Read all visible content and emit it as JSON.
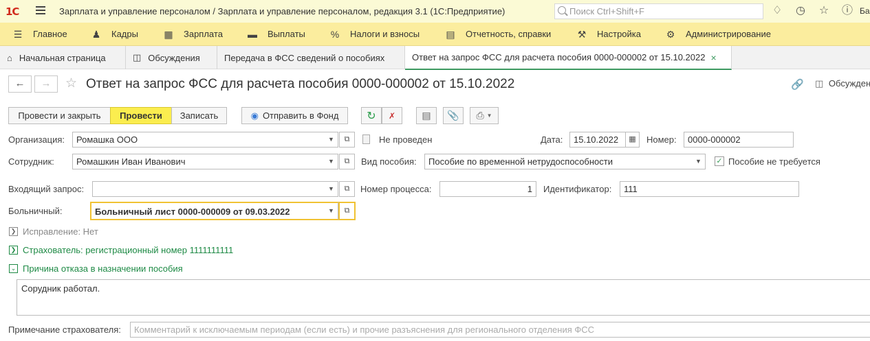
{
  "titlebar": {
    "logo": "1С",
    "title": "Зарплата и управление персоналом / Зарплата и управление персоналом, редакция 3.1  (1С:Предприятие)",
    "search_placeholder": "Поиск Ctrl+Shift+F",
    "user": "Ба"
  },
  "sections": [
    {
      "label": "Главное",
      "icon": "menu-icon"
    },
    {
      "label": "Кадры",
      "icon": "people-icon"
    },
    {
      "label": "Зарплата",
      "icon": "calculator-icon"
    },
    {
      "label": "Выплаты",
      "icon": "wallet-icon"
    },
    {
      "label": "Налоги и взносы",
      "icon": "percent-icon"
    },
    {
      "label": "Отчетность, справки",
      "icon": "reports-icon"
    },
    {
      "label": "Настройка",
      "icon": "wrench-icon"
    },
    {
      "label": "Администрирование",
      "icon": "gear-icon"
    }
  ],
  "tabs": [
    {
      "label": "Начальная страница",
      "icon": "home-icon"
    },
    {
      "label": "Обсуждения",
      "icon": "chat-icon"
    },
    {
      "label": "Передача в ФСС сведений о пособиях"
    },
    {
      "label": "Ответ на запрос ФСС для расчета пособия 0000-000002 от 15.10.2022",
      "close": "×"
    }
  ],
  "form": {
    "title": "Ответ на запрос ФСС для расчета пособия 0000-000002 от 15.10.2022",
    "discussions": "Обсужден"
  },
  "toolbar": {
    "post_close": "Провести и закрыть",
    "post": "Провести",
    "save": "Записать",
    "send_fund": "Отправить в Фонд"
  },
  "fields": {
    "org_label": "Организация:",
    "org_value": "Ромашка ООО",
    "status": "Не проведен",
    "date_label": "Дата:",
    "date_value": "15.10.2022",
    "number_label": "Номер:",
    "number_value": "0000-000002",
    "employee_label": "Сотрудник:",
    "employee_value": "Ромашкин Иван Иванович",
    "benefit_type_label": "Вид пособия:",
    "benefit_type_value": "Пособие по временной нетрудоспособности",
    "not_required_label": "Пособие не требуется",
    "not_required_checked": true,
    "incoming_label": "Входящий запрос:",
    "incoming_value": "",
    "process_label": "Номер процесса:",
    "process_value": "1",
    "ident_label": "Идентификатор:",
    "ident_value": "111",
    "sick_label": "Больничный:",
    "sick_value": "Больничный лист 0000-000009 от 09.03.2022"
  },
  "groups": {
    "correction": "Исправление: Нет",
    "insurer": "Страхователь: регистрационный номер 1111111111",
    "refusal": "Причина отказа в назначении пособия"
  },
  "refusal_text": "Сорудник работал.",
  "note": {
    "label": "Примечание страхователя:",
    "placeholder": "Комментарий к исключаемым периодам (если есть) и прочие разъяснения для регионального отделения ФСС"
  },
  "colors": {
    "titlebar_bg": "#fbfad5",
    "sections_bg": "#fbed9e",
    "accent_green": "#1e8a45",
    "primary_button": "#fbed4f"
  }
}
